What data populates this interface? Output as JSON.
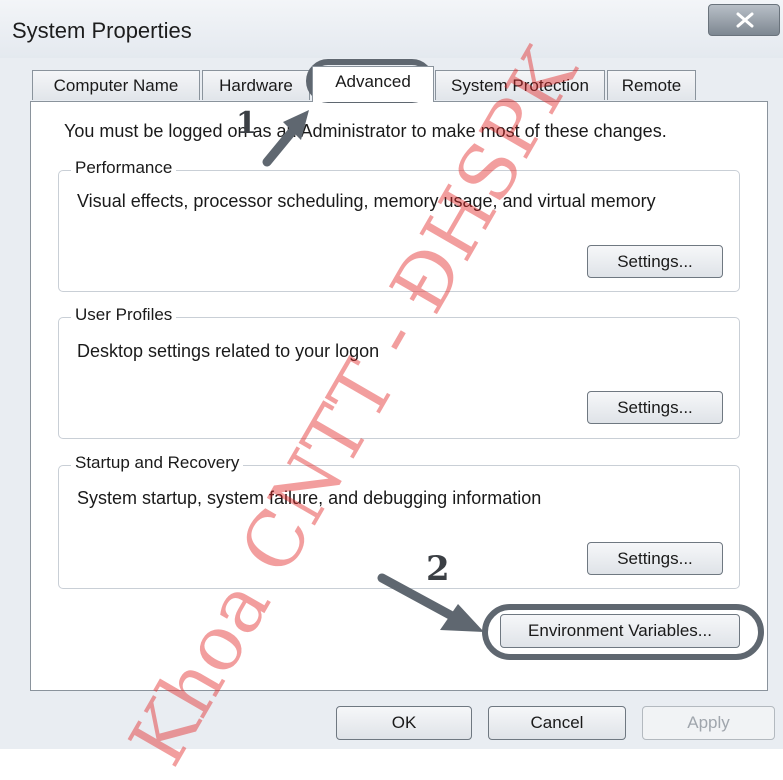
{
  "window": {
    "title": "System Properties"
  },
  "tabs": [
    {
      "label": "Computer Name"
    },
    {
      "label": "Hardware"
    },
    {
      "label": "Advanced"
    },
    {
      "label": "System Protection"
    },
    {
      "label": "Remote"
    }
  ],
  "active_tab": "Advanced",
  "admin_note": "You must be logged on as an Administrator to make most of these changes.",
  "groups": {
    "performance": {
      "title": "Performance",
      "description": "Visual effects, processor scheduling, memory usage, and virtual memory",
      "button": "Settings..."
    },
    "user_profiles": {
      "title": "User Profiles",
      "description": "Desktop settings related to your logon",
      "button": "Settings..."
    },
    "startup_recovery": {
      "title": "Startup and Recovery",
      "description": "System startup, system failure, and debugging information",
      "button": "Settings..."
    }
  },
  "environment_button": "Environment Variables...",
  "footer": {
    "ok": "OK",
    "cancel": "Cancel",
    "apply": "Apply"
  },
  "annotations": {
    "step1": "1",
    "step2": "2"
  },
  "watermark": "Khoa CNTT - ĐHSPK",
  "colors": {
    "watermark": "#e22828",
    "annotation": "#5f6770"
  }
}
